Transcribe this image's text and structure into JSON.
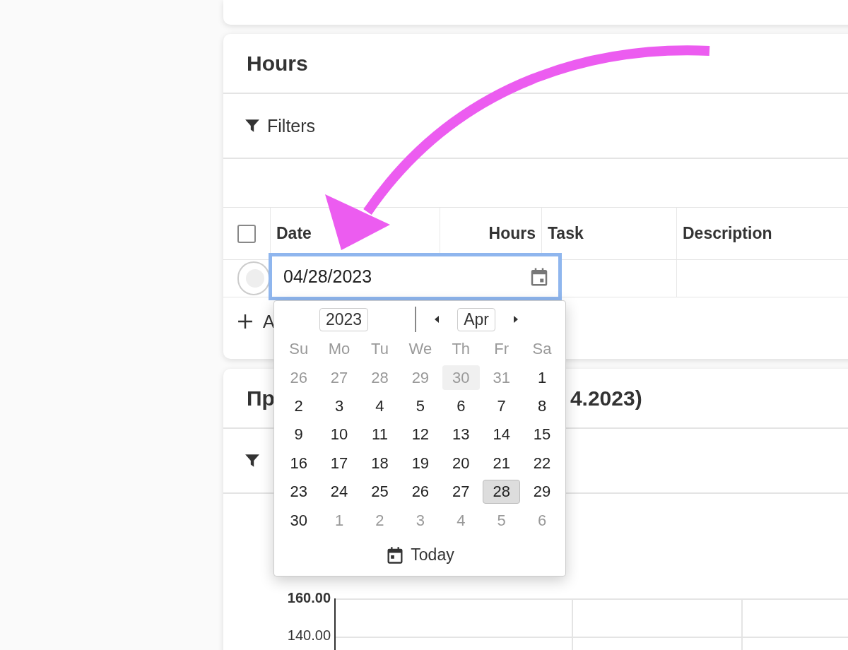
{
  "hours_card": {
    "title": "Hours",
    "filters_label": "Filters",
    "table": {
      "select_all_checked": false,
      "columns": [
        {
          "label": "Date",
          "kind": "text"
        },
        {
          "label": "Hours",
          "kind": "number"
        },
        {
          "label": "Task",
          "kind": "text"
        },
        {
          "label": "Description",
          "kind": "text"
        }
      ],
      "add_label": "A"
    }
  },
  "date_editor": {
    "value": "04/28/2023",
    "calendar": {
      "year": "2023",
      "month": "Apr",
      "weekdays": [
        "Su",
        "Mo",
        "Tu",
        "We",
        "Th",
        "Fr",
        "Sa"
      ],
      "weeks": [
        [
          {
            "day": "26",
            "outside": true,
            "selected": false,
            "highlighted": false
          },
          {
            "day": "27",
            "outside": true,
            "selected": false,
            "highlighted": false
          },
          {
            "day": "28",
            "outside": true,
            "selected": false,
            "highlighted": false
          },
          {
            "day": "29",
            "outside": true,
            "selected": false,
            "highlighted": false
          },
          {
            "day": "30",
            "outside": true,
            "selected": false,
            "highlighted": true
          },
          {
            "day": "31",
            "outside": true,
            "selected": false,
            "highlighted": false
          },
          {
            "day": "1",
            "outside": false,
            "selected": false,
            "highlighted": false
          }
        ],
        [
          {
            "day": "2",
            "outside": false,
            "selected": false,
            "highlighted": false
          },
          {
            "day": "3",
            "outside": false,
            "selected": false,
            "highlighted": false
          },
          {
            "day": "4",
            "outside": false,
            "selected": false,
            "highlighted": false
          },
          {
            "day": "5",
            "outside": false,
            "selected": false,
            "highlighted": false
          },
          {
            "day": "6",
            "outside": false,
            "selected": false,
            "highlighted": false
          },
          {
            "day": "7",
            "outside": false,
            "selected": false,
            "highlighted": false
          },
          {
            "day": "8",
            "outside": false,
            "selected": false,
            "highlighted": false
          }
        ],
        [
          {
            "day": "9",
            "outside": false,
            "selected": false,
            "highlighted": false
          },
          {
            "day": "10",
            "outside": false,
            "selected": false,
            "highlighted": false
          },
          {
            "day": "11",
            "outside": false,
            "selected": false,
            "highlighted": false
          },
          {
            "day": "12",
            "outside": false,
            "selected": false,
            "highlighted": false
          },
          {
            "day": "13",
            "outside": false,
            "selected": false,
            "highlighted": false
          },
          {
            "day": "14",
            "outside": false,
            "selected": false,
            "highlighted": false
          },
          {
            "day": "15",
            "outside": false,
            "selected": false,
            "highlighted": false
          }
        ],
        [
          {
            "day": "16",
            "outside": false,
            "selected": false,
            "highlighted": false
          },
          {
            "day": "17",
            "outside": false,
            "selected": false,
            "highlighted": false
          },
          {
            "day": "18",
            "outside": false,
            "selected": false,
            "highlighted": false
          },
          {
            "day": "19",
            "outside": false,
            "selected": false,
            "highlighted": false
          },
          {
            "day": "20",
            "outside": false,
            "selected": false,
            "highlighted": false
          },
          {
            "day": "21",
            "outside": false,
            "selected": false,
            "highlighted": false
          },
          {
            "day": "22",
            "outside": false,
            "selected": false,
            "highlighted": false
          }
        ],
        [
          {
            "day": "23",
            "outside": false,
            "selected": false,
            "highlighted": false
          },
          {
            "day": "24",
            "outside": false,
            "selected": false,
            "highlighted": false
          },
          {
            "day": "25",
            "outside": false,
            "selected": false,
            "highlighted": false
          },
          {
            "day": "26",
            "outside": false,
            "selected": false,
            "highlighted": false
          },
          {
            "day": "27",
            "outside": false,
            "selected": false,
            "highlighted": false
          },
          {
            "day": "28",
            "outside": false,
            "selected": true,
            "highlighted": false
          },
          {
            "day": "29",
            "outside": false,
            "selected": false,
            "highlighted": false
          }
        ],
        [
          {
            "day": "30",
            "outside": false,
            "selected": false,
            "highlighted": false
          },
          {
            "day": "1",
            "outside": true,
            "selected": false,
            "highlighted": false
          },
          {
            "day": "2",
            "outside": true,
            "selected": false,
            "highlighted": false
          },
          {
            "day": "3",
            "outside": true,
            "selected": false,
            "highlighted": false
          },
          {
            "day": "4",
            "outside": true,
            "selected": false,
            "highlighted": false
          },
          {
            "day": "5",
            "outside": true,
            "selected": false,
            "highlighted": false
          },
          {
            "day": "6",
            "outside": true,
            "selected": false,
            "highlighted": false
          }
        ]
      ],
      "today_label": "Today"
    }
  },
  "second_card": {
    "title_start": "Пр",
    "title_end": "4.2023)",
    "y_ticks": [
      {
        "label": "160.00",
        "bold": true
      },
      {
        "label": "140.00",
        "bold": false
      }
    ]
  }
}
